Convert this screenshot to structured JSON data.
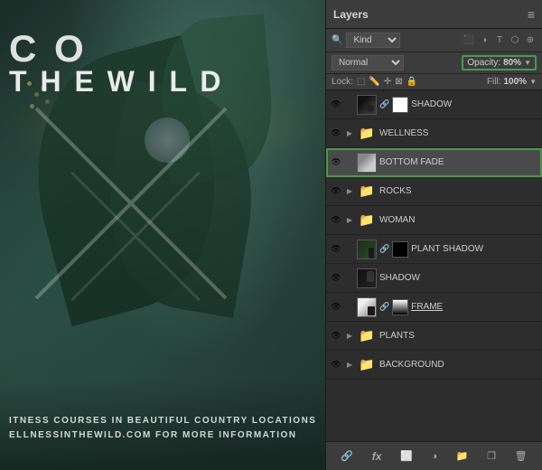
{
  "canvas": {
    "text_top": "C O",
    "text_the": "T H E  W I L D",
    "bottom_line1": "ITNESS COURSES IN BEAUTIFUL COUNTRY LOCATIONS",
    "bottom_line2": "ELLNESSINTHEWILD.COM FOR MORE INFORMATION"
  },
  "panel": {
    "title": "Layers",
    "menu_icon": "≡",
    "filter": {
      "label": "Kind",
      "icons": [
        "pixel",
        "adjust",
        "type",
        "shape",
        "fx"
      ]
    },
    "blend": {
      "mode": "Normal",
      "opacity_label": "Opacity:",
      "opacity_value": "80%",
      "fill_label": "Fill:",
      "fill_value": "100%"
    },
    "lock": {
      "label": "Lock:",
      "fill_label": "Fill:",
      "fill_value": "100%"
    },
    "layers": [
      {
        "id": 1,
        "name": "SHADOW",
        "type": "layer",
        "visible": true,
        "active": false,
        "has_mask": true,
        "has_chain": true,
        "indent": 0,
        "mask_style": "white"
      },
      {
        "id": 2,
        "name": "WELLNESS",
        "type": "folder",
        "visible": true,
        "active": false,
        "has_mask": false,
        "has_chain": false,
        "indent": 0
      },
      {
        "id": 3,
        "name": "BOTTOM FADE",
        "type": "layer",
        "visible": true,
        "active": true,
        "has_mask": false,
        "has_chain": false,
        "indent": 0,
        "mask_style": "fade"
      },
      {
        "id": 4,
        "name": "ROCKS",
        "type": "folder",
        "visible": true,
        "active": false,
        "has_mask": false,
        "has_chain": false,
        "indent": 0
      },
      {
        "id": 5,
        "name": "WOMAN",
        "type": "folder",
        "visible": true,
        "active": false,
        "has_mask": false,
        "has_chain": false,
        "indent": 0
      },
      {
        "id": 6,
        "name": "PLANT SHADOW",
        "type": "layer",
        "visible": true,
        "active": false,
        "has_mask": true,
        "has_chain": true,
        "indent": 0,
        "mask_style": "black"
      },
      {
        "id": 7,
        "name": "SHADOW",
        "type": "layer",
        "visible": true,
        "active": false,
        "has_mask": false,
        "has_chain": false,
        "indent": 0,
        "mask_style": "shadow2"
      },
      {
        "id": 8,
        "name": "FRAME",
        "type": "layer",
        "visible": true,
        "active": false,
        "has_mask": true,
        "has_chain": true,
        "indent": 0,
        "mask_style": "frame",
        "underline": true
      },
      {
        "id": 9,
        "name": "PLANTS",
        "type": "folder",
        "visible": true,
        "active": false,
        "has_mask": false,
        "has_chain": false,
        "indent": 0
      },
      {
        "id": 10,
        "name": "BACKGROUND",
        "type": "folder",
        "visible": true,
        "active": false,
        "has_mask": false,
        "has_chain": false,
        "indent": 0
      }
    ],
    "footer": {
      "link_icon": "🔗",
      "fx_label": "fx",
      "adjust_icon": "◑",
      "mask_icon": "⬜",
      "folder_icon": "📁",
      "duplicate_icon": "❐",
      "delete_icon": "🗑"
    }
  }
}
